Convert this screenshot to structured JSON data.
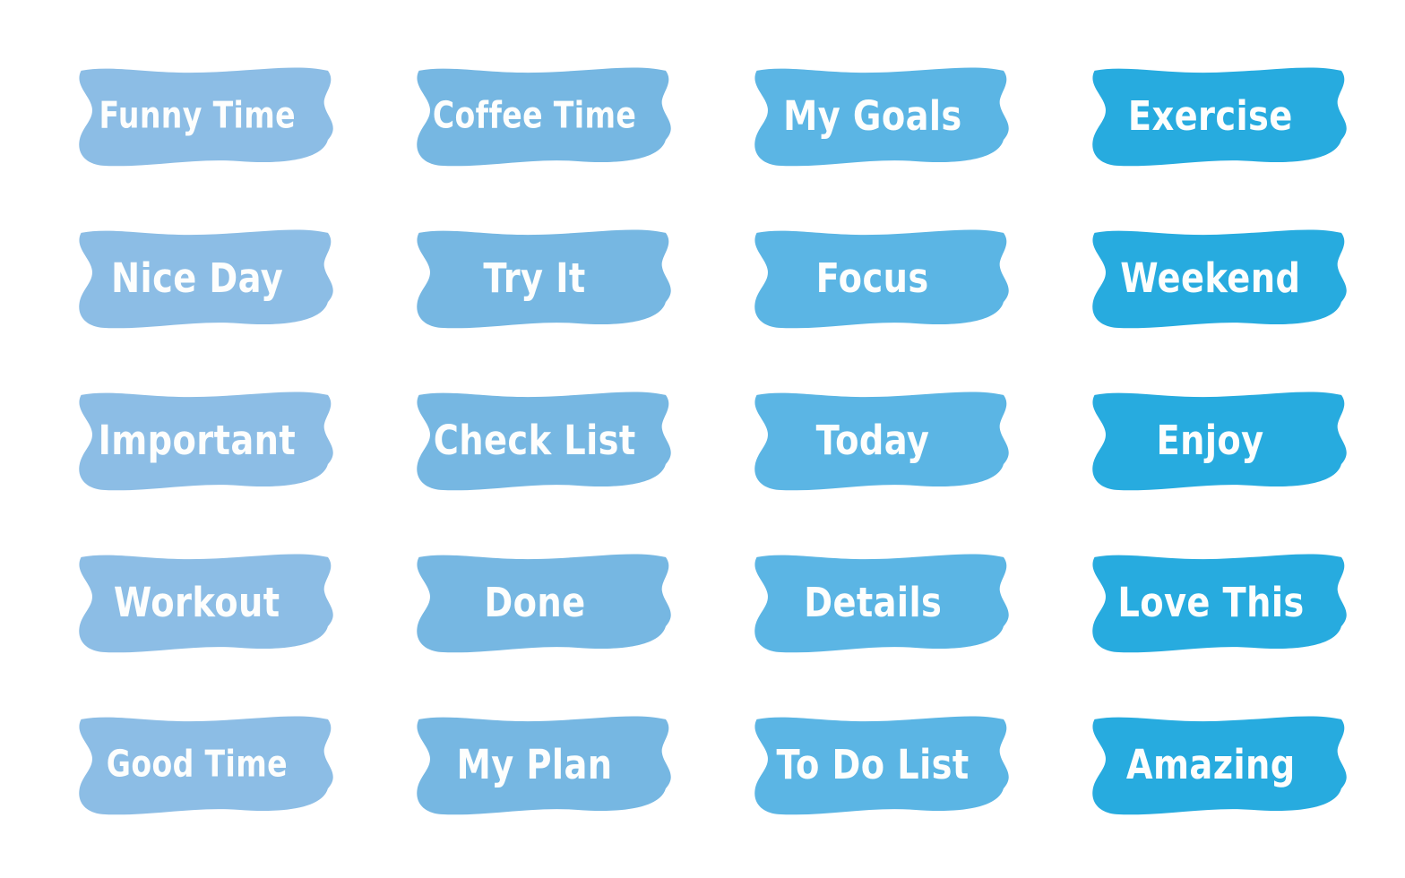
{
  "sheet": {
    "background_color": "#ffffff",
    "label_text_color": "#fdfefd",
    "columns": 4,
    "rows": 5,
    "total_banners": 20
  },
  "column_colors": [
    {
      "name": "column-1-light-blue",
      "hex": "#8CBDE5"
    },
    {
      "name": "column-2-medium-blue",
      "hex": "#76B7E2"
    },
    {
      "name": "column-3-sky-blue",
      "hex": "#5BB5E4"
    },
    {
      "name": "column-4-vivid-cyan",
      "hex": "#27ABDF"
    }
  ],
  "banners": [
    {
      "label": "Funny Time",
      "column": 1,
      "row": 1,
      "color": "#8CBDE5",
      "long": true
    },
    {
      "label": "Coffee Time",
      "column": 2,
      "row": 1,
      "color": "#76B7E2",
      "long": true
    },
    {
      "label": "My Goals",
      "column": 3,
      "row": 1,
      "color": "#5BB5E4",
      "long": false
    },
    {
      "label": "Exercise",
      "column": 4,
      "row": 1,
      "color": "#27ABDF",
      "long": false
    },
    {
      "label": "Nice Day",
      "column": 1,
      "row": 2,
      "color": "#8CBDE5",
      "long": false
    },
    {
      "label": "Try It",
      "column": 2,
      "row": 2,
      "color": "#76B7E2",
      "long": false
    },
    {
      "label": "Focus",
      "column": 3,
      "row": 2,
      "color": "#5BB5E4",
      "long": false
    },
    {
      "label": "Weekend",
      "column": 4,
      "row": 2,
      "color": "#27ABDF",
      "long": false
    },
    {
      "label": "Important",
      "column": 1,
      "row": 3,
      "color": "#8CBDE5",
      "long": false
    },
    {
      "label": "Check List",
      "column": 2,
      "row": 3,
      "color": "#76B7E2",
      "long": false
    },
    {
      "label": "Today",
      "column": 3,
      "row": 3,
      "color": "#5BB5E4",
      "long": false
    },
    {
      "label": "Enjoy",
      "column": 4,
      "row": 3,
      "color": "#27ABDF",
      "long": false
    },
    {
      "label": "Workout",
      "column": 1,
      "row": 4,
      "color": "#8CBDE5",
      "long": false
    },
    {
      "label": "Done",
      "column": 2,
      "row": 4,
      "color": "#76B7E2",
      "long": false
    },
    {
      "label": "Details",
      "column": 3,
      "row": 4,
      "color": "#5BB5E4",
      "long": false
    },
    {
      "label": "Love This",
      "column": 4,
      "row": 4,
      "color": "#27ABDF",
      "long": false
    },
    {
      "label": "Good Time",
      "column": 1,
      "row": 5,
      "color": "#8CBDE5",
      "long": true
    },
    {
      "label": "My Plan",
      "column": 2,
      "row": 5,
      "color": "#76B7E2",
      "long": false
    },
    {
      "label": "To Do List",
      "column": 3,
      "row": 5,
      "color": "#5BB5E4",
      "long": false
    },
    {
      "label": "Amazing",
      "column": 4,
      "row": 5,
      "color": "#27ABDF",
      "long": false
    }
  ]
}
